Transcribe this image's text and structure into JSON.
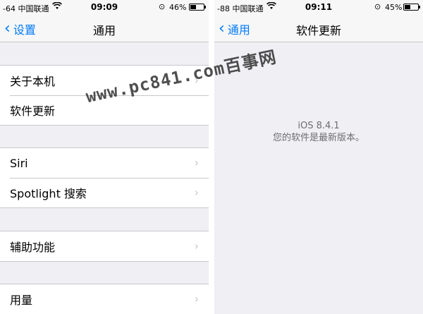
{
  "left": {
    "status": {
      "signal": "-64",
      "carrier": "中国联通",
      "time": "09:09",
      "battery_pct": "46%",
      "battery_level": 0.46
    },
    "nav": {
      "back_label": "设置",
      "title": "通用"
    },
    "groups": [
      {
        "items": [
          {
            "label": "关于本机"
          },
          {
            "label": "软件更新"
          }
        ]
      },
      {
        "items": [
          {
            "label": "Siri"
          },
          {
            "label": "Spotlight 搜索"
          }
        ]
      },
      {
        "items": [
          {
            "label": "辅助功能"
          }
        ]
      },
      {
        "items": [
          {
            "label": "用量"
          }
        ]
      }
    ]
  },
  "right": {
    "status": {
      "signal": "-88",
      "carrier": "中国联通",
      "time": "09:11",
      "battery_pct": "45%",
      "battery_level": 0.45
    },
    "nav": {
      "back_label": "通用",
      "title": "软件更新"
    },
    "update": {
      "version": "iOS 8.4.1",
      "message": "您的软件是最新版本。"
    }
  },
  "watermark": "www.pc841.com百事网",
  "icons": {
    "back": "chevron-left-icon",
    "disclosure": "chevron-right-icon",
    "wifi": "wifi-icon",
    "rotation_lock": "rotation-lock-icon",
    "battery": "battery-icon"
  },
  "colors": {
    "accent": "#007aff",
    "background": "#efeff4",
    "bar": "#f7f7f7",
    "separator": "#c8c7cc"
  }
}
